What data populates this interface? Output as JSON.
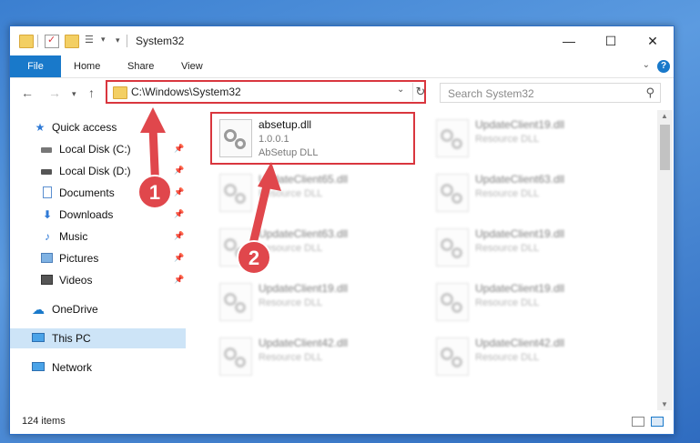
{
  "window": {
    "title": "System32"
  },
  "ribbon": {
    "file_label": "File",
    "tabs": [
      "Home",
      "Share",
      "View"
    ],
    "help": "?"
  },
  "nav": {
    "back": "←",
    "forward": "→",
    "up": "↑",
    "address": "C:\\Windows\\System32",
    "search_placeholder": "Search System32"
  },
  "sidebar": {
    "items": [
      {
        "label": "Quick access",
        "icon": "star-icon"
      },
      {
        "label": "Local Disk (C:)",
        "icon": "drive-icon"
      },
      {
        "label": "Local Disk (D:)",
        "icon": "drive-icon"
      },
      {
        "label": "Documents",
        "icon": "documents-icon"
      },
      {
        "label": "Downloads",
        "icon": "download-icon"
      },
      {
        "label": "Music",
        "icon": "music-icon"
      },
      {
        "label": "Pictures",
        "icon": "pictures-icon"
      },
      {
        "label": "Videos",
        "icon": "videos-icon"
      },
      {
        "label": "OneDrive",
        "icon": "cloud-icon"
      },
      {
        "label": "This PC",
        "icon": "computer-icon"
      },
      {
        "label": "Network",
        "icon": "network-icon"
      }
    ]
  },
  "files": {
    "highlighted": {
      "name": "absetup.dll",
      "version": "1.0.0.1",
      "desc": "AbSetup DLL"
    },
    "left_col": [
      {
        "name": "UpdateClient65.dll",
        "desc": "Resource DLL"
      },
      {
        "name": "UpdateClient63.dll",
        "desc": "Resource DLL"
      },
      {
        "name": "UpdateClient19.dll",
        "desc": "Resource DLL"
      },
      {
        "name": "UpdateClient42.dll",
        "desc": "Resource DLL"
      }
    ],
    "right_col": [
      {
        "name": "UpdateClient19.dll",
        "desc": "Resource DLL"
      },
      {
        "name": "UpdateClient63.dll",
        "desc": "Resource DLL"
      },
      {
        "name": "UpdateClient19.dll",
        "desc": "Resource DLL"
      },
      {
        "name": "UpdateClient19.dll",
        "desc": "Resource DLL"
      },
      {
        "name": "UpdateClient42.dll",
        "desc": "Resource DLL"
      }
    ]
  },
  "status": {
    "count": "124 items"
  },
  "annotations": {
    "step1": "1",
    "step2": "2"
  },
  "colors": {
    "accent": "#1979ca",
    "highlight": "#d9363e",
    "annotation": "#e0474c"
  }
}
